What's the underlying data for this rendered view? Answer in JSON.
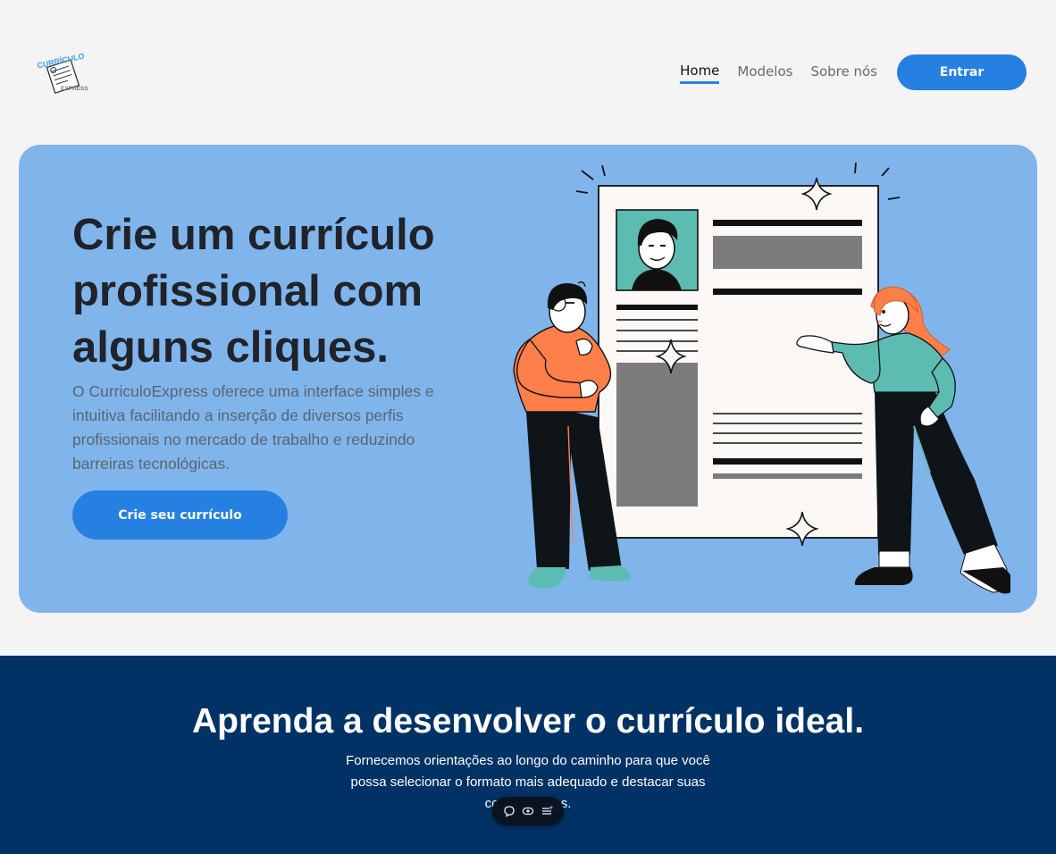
{
  "header": {
    "logo": {
      "text_top": "CURRÍCULO",
      "text_bottom": "EXPRESS",
      "icon": "resume-document-icon"
    },
    "nav": {
      "home": "Home",
      "models": "Modelos",
      "about": "Sobre nós"
    },
    "login_button": "Entrar"
  },
  "hero": {
    "title": "Crie um currículo profissional com alguns cliques.",
    "description": "O CurriculoExpress oferece uma interface simples e intuitiva facilitando a inserção de diversos perfis profissionais no mercado de trabalho e reduzindo barreiras tecnológicas.",
    "cta_button": "Crie seu currículo",
    "illustration": "people-presenting-resume-illustration"
  },
  "section2": {
    "title": "Aprenda a desenvolver o currículo ideal.",
    "text": "Fornecemos orientações ao longo do caminho para que você possa selecionar o formato mais adequado e destacar suas competências."
  },
  "toolbar": {
    "icons": [
      "comment-icon",
      "eye-icon",
      "menu-icon"
    ]
  },
  "colors": {
    "background": "#f4f4f4",
    "hero_bg": "#80b5ec",
    "accent": "#2680e2",
    "section_dark": "#003266",
    "person_orange": "#ff7f4a",
    "person_teal": "#5bbcb4"
  }
}
